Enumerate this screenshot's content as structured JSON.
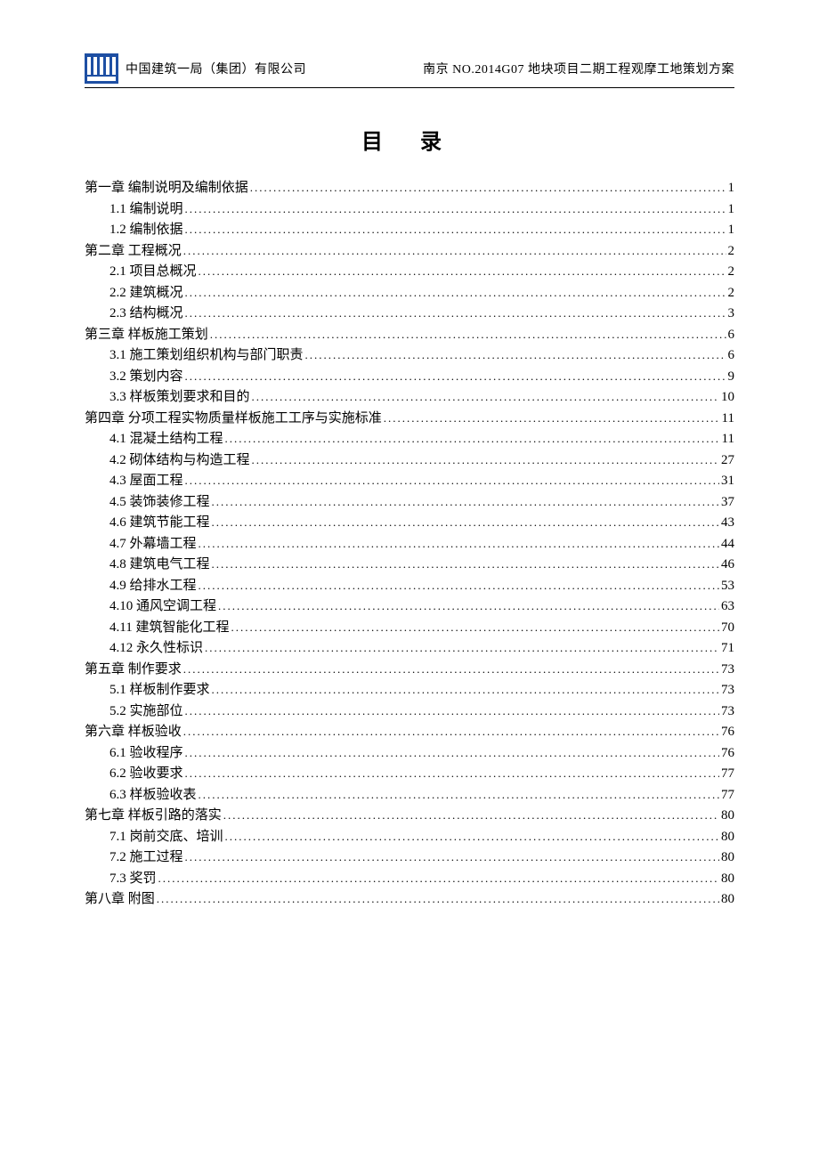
{
  "header": {
    "company": "中国建筑一局（集团）有限公司",
    "project": "南京 NO.2014G07 地块项目二期工程观摩工地策划方案"
  },
  "title": "目  录",
  "toc": [
    {
      "level": 1,
      "label": "第一章  编制说明及编制依据",
      "page": "1"
    },
    {
      "level": 2,
      "label": "1.1 编制说明",
      "page": "1"
    },
    {
      "level": 2,
      "label": "1.2 编制依据",
      "page": "1"
    },
    {
      "level": 1,
      "label": "第二章  工程概况",
      "page": "2"
    },
    {
      "level": 2,
      "label": "2.1 项目总概况",
      "page": "2"
    },
    {
      "level": 2,
      "label": "2.2 建筑概况",
      "page": "2"
    },
    {
      "level": 2,
      "label": "2.3 结构概况",
      "page": "3"
    },
    {
      "level": 1,
      "label": "第三章  样板施工策划",
      "page": "6"
    },
    {
      "level": 2,
      "label": "3.1 施工策划组织机构与部门职责",
      "page": "6"
    },
    {
      "level": 2,
      "label": "3.2 策划内容",
      "page": "9"
    },
    {
      "level": 2,
      "label": "3.3 样板策划要求和目的",
      "page": "10"
    },
    {
      "level": 1,
      "label": "第四章  分项工程实物质量样板施工工序与实施标准",
      "page": "11"
    },
    {
      "level": 2,
      "label": "4.1 混凝土结构工程",
      "page": "11"
    },
    {
      "level": 2,
      "label": "4.2 砌体结构与构造工程",
      "page": "27"
    },
    {
      "level": 2,
      "label": "4.3 屋面工程",
      "page": "31"
    },
    {
      "level": 2,
      "label": "4.5 装饰装修工程",
      "page": "37"
    },
    {
      "level": 2,
      "label": "4.6 建筑节能工程",
      "page": "43"
    },
    {
      "level": 2,
      "label": "4.7 外幕墙工程",
      "page": "44"
    },
    {
      "level": 2,
      "label": "4.8 建筑电气工程",
      "page": "46"
    },
    {
      "level": 2,
      "label": "4.9 给排水工程",
      "page": "53"
    },
    {
      "level": 2,
      "label": "4.10 通风空调工程",
      "page": "63"
    },
    {
      "level": 2,
      "label": "4.11 建筑智能化工程",
      "page": "70"
    },
    {
      "level": 2,
      "label": "4.12 永久性标识",
      "page": "71"
    },
    {
      "level": 1,
      "label": "第五章  制作要求",
      "page": "73"
    },
    {
      "level": 2,
      "label": "5.1 样板制作要求",
      "page": "73"
    },
    {
      "level": 2,
      "label": "5.2 实施部位",
      "page": "73"
    },
    {
      "level": 1,
      "label": "第六章  样板验收",
      "page": "76"
    },
    {
      "level": 2,
      "label": "6.1 验收程序",
      "page": "76"
    },
    {
      "level": 2,
      "label": "6.2 验收要求",
      "page": "77"
    },
    {
      "level": 2,
      "label": "6.3 样板验收表",
      "page": "77"
    },
    {
      "level": 1,
      "label": "第七章  样板引路的落实",
      "page": "80"
    },
    {
      "level": 2,
      "label": "7.1 岗前交底、培训",
      "page": "80"
    },
    {
      "level": 2,
      "label": "7.2 施工过程",
      "page": "80"
    },
    {
      "level": 2,
      "label": "7.3 奖罚",
      "page": "80"
    },
    {
      "level": 1,
      "label": "第八章  附图",
      "page": "80"
    }
  ]
}
